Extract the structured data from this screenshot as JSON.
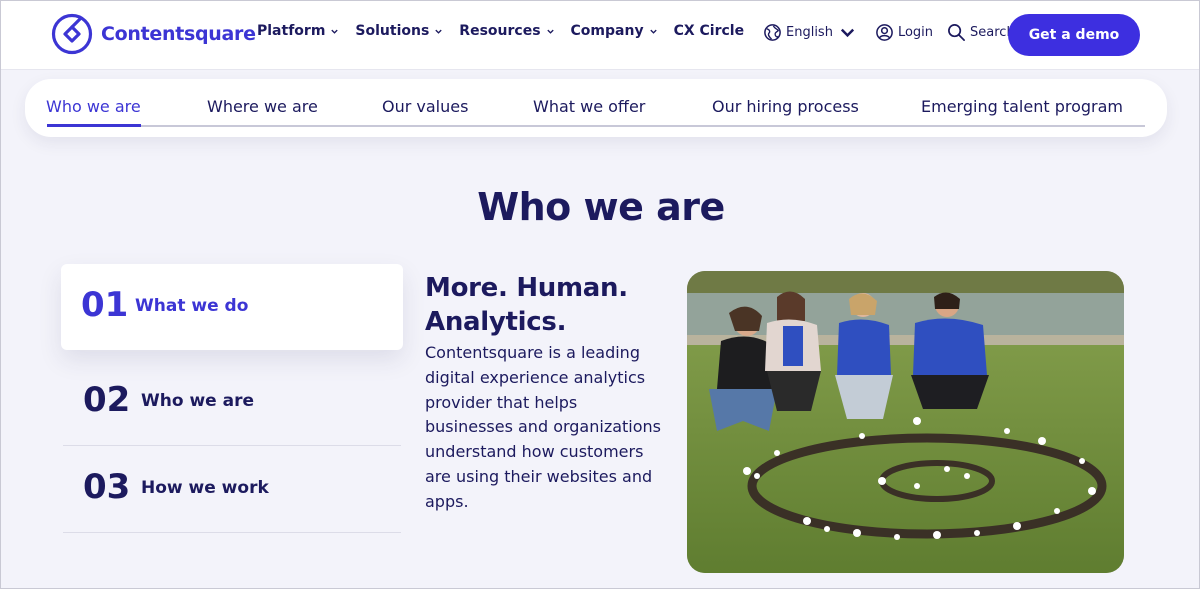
{
  "brand": {
    "name": "Contentsquare",
    "accent": "#3c35d4",
    "button": "#3d2fe0",
    "text": "#1c1a5e"
  },
  "nav": {
    "items": [
      "Platform",
      "Solutions",
      "Resources",
      "Company",
      "CX Circle"
    ]
  },
  "right_nav": {
    "language": "English",
    "login": "Login",
    "search": "Search",
    "cta": "Get a demo"
  },
  "tabs": [
    "Who we are",
    "Where we are",
    "Our values",
    "What we offer",
    "Our hiring process",
    "Emerging talent program"
  ],
  "active_tab": "Who we are",
  "section": {
    "title": "Who we are",
    "items": [
      {
        "num": "01",
        "label": "What we do",
        "active": true
      },
      {
        "num": "02",
        "label": "Who we are",
        "active": false
      },
      {
        "num": "03",
        "label": "How we work",
        "active": false
      }
    ],
    "headline": "More. Human. Analytics.",
    "body": "Contentsquare is a leading digital experience analytics provider that helps businesses and organizations understand how customers are using their websites and apps.",
    "photo_icon": "team-photo-icon"
  }
}
